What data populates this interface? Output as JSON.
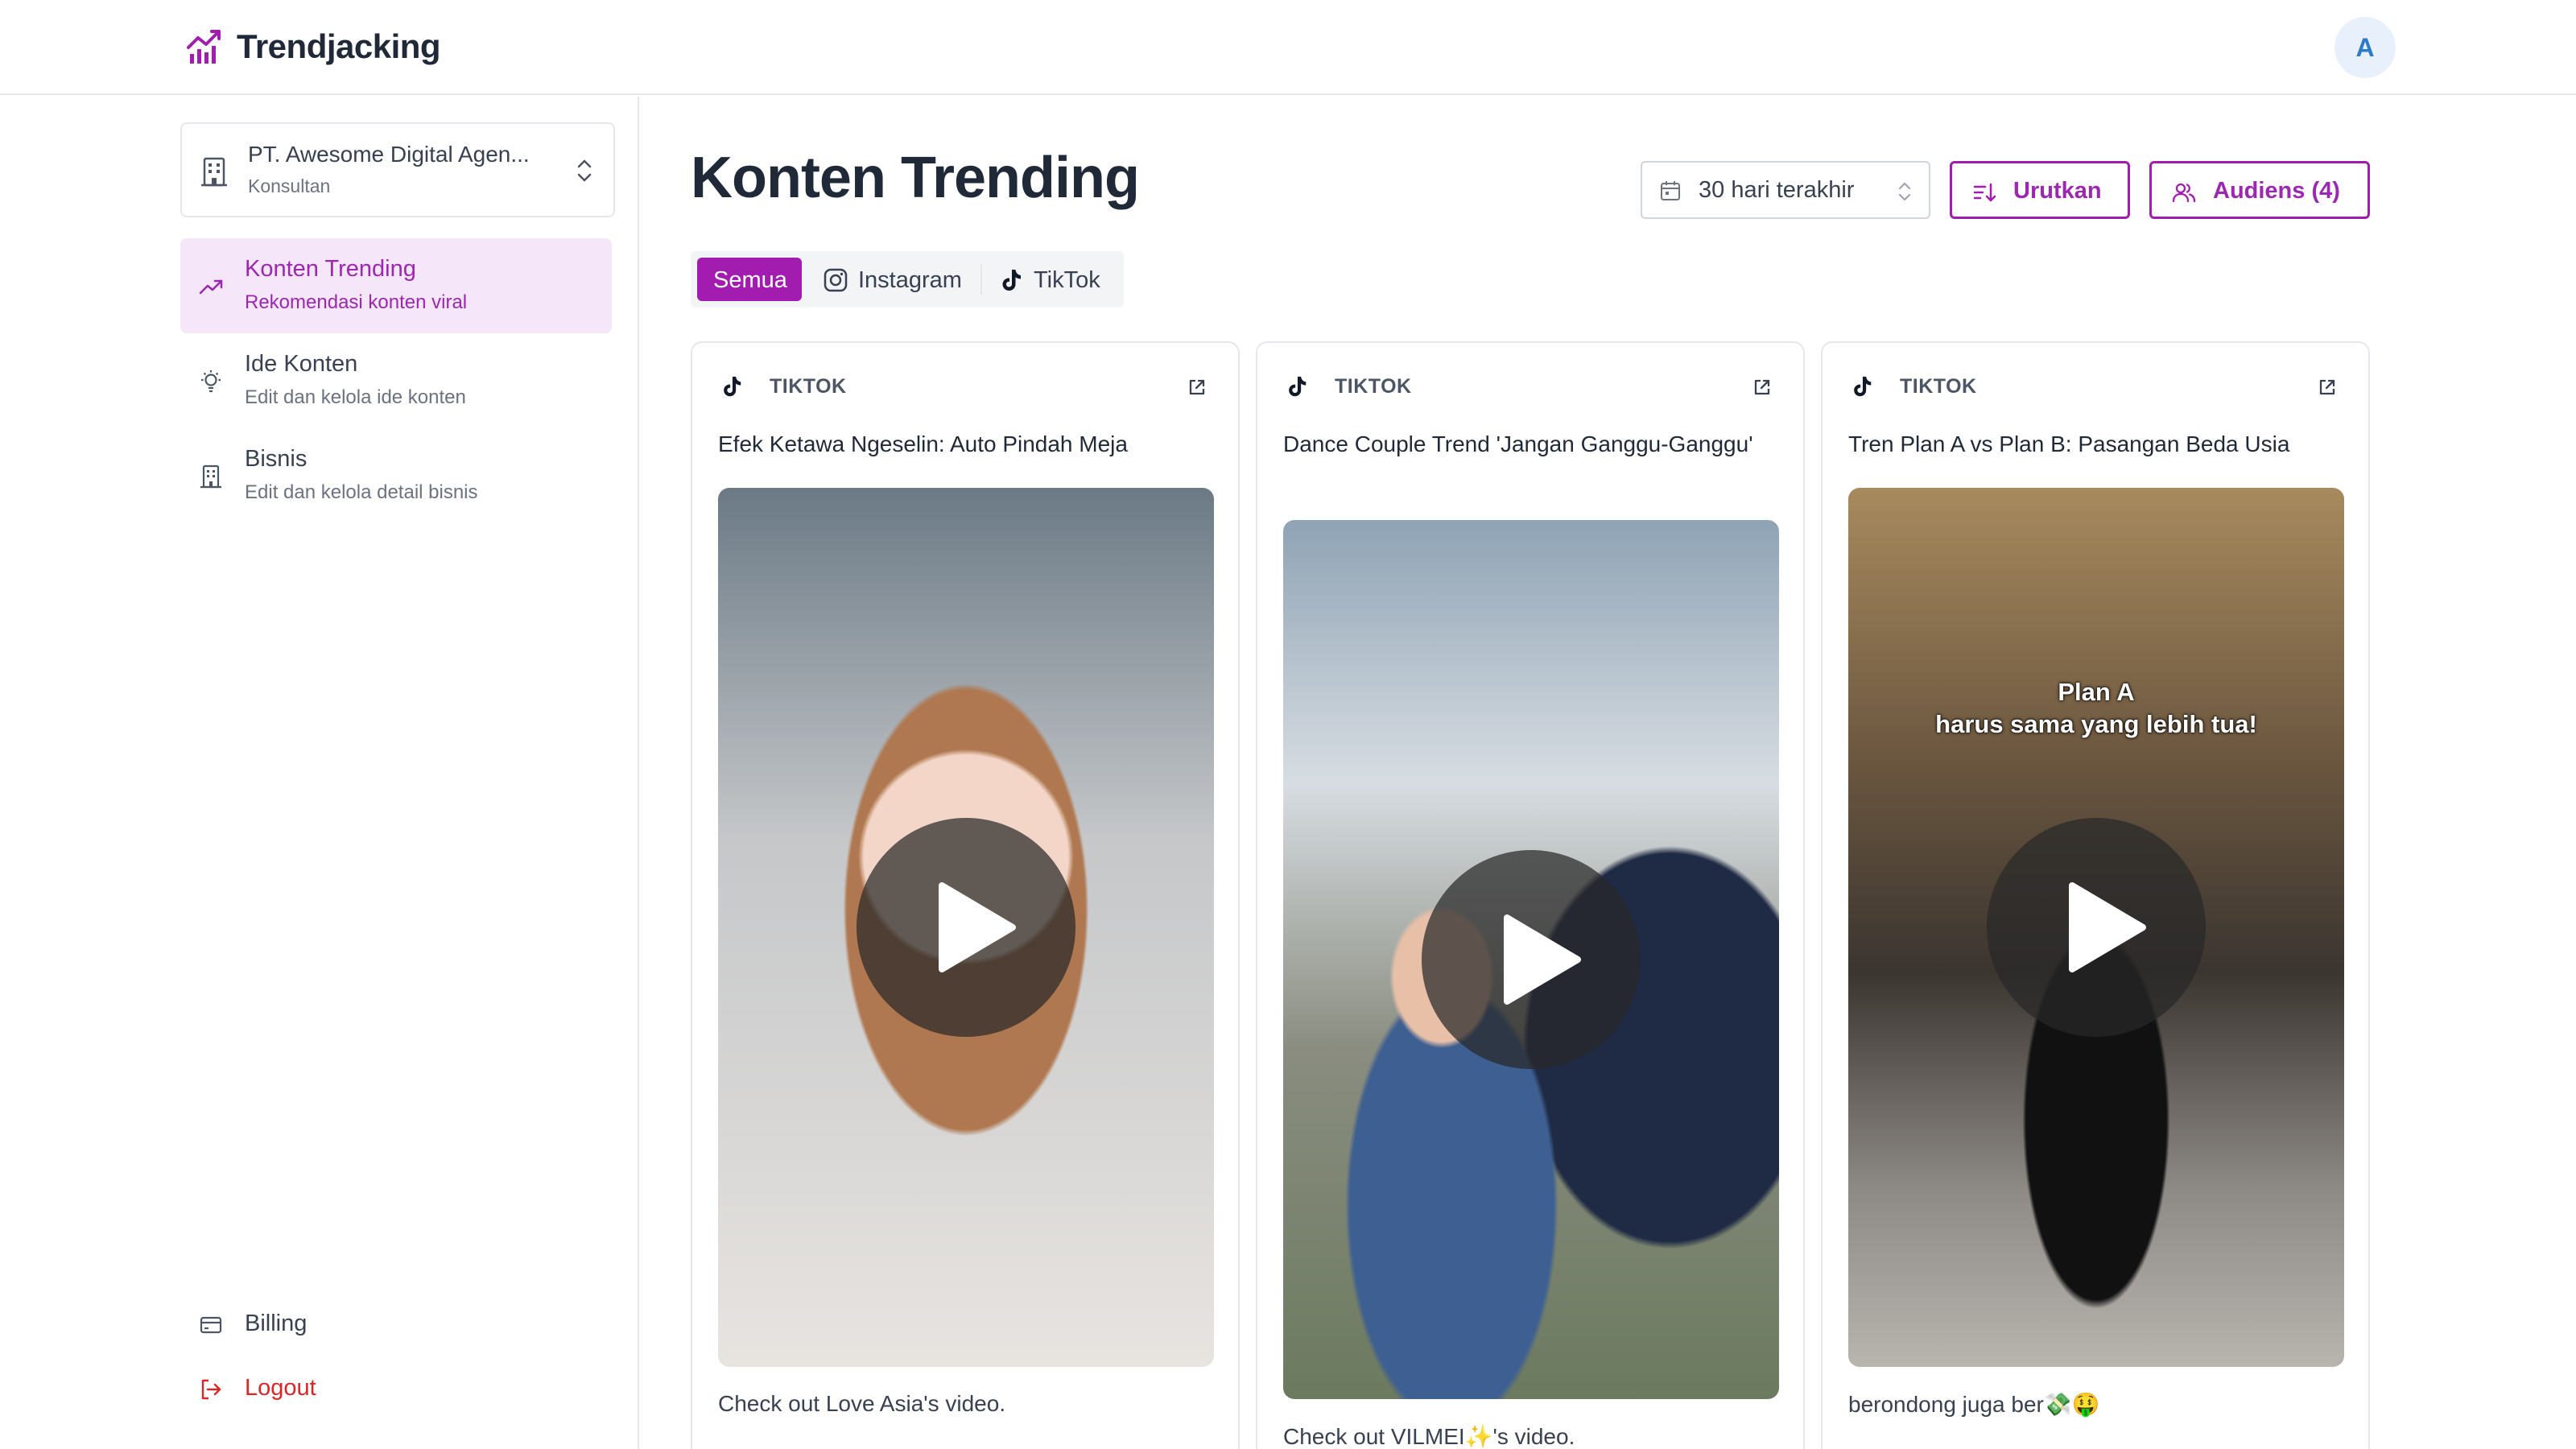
{
  "header": {
    "brand": "Trendjacking",
    "avatar_initial": "A"
  },
  "sidebar": {
    "org": {
      "name": "PT. Awesome Digital Agen...",
      "role": "Konsultan"
    },
    "items": [
      {
        "title": "Konten Trending",
        "subtitle": "Rekomendasi konten viral",
        "icon": "trending-up-icon",
        "active": true
      },
      {
        "title": "Ide Konten",
        "subtitle": "Edit dan kelola ide konten",
        "icon": "lightbulb-icon",
        "active": false
      },
      {
        "title": "Bisnis",
        "subtitle": "Edit dan kelola detail bisnis",
        "icon": "building-icon",
        "active": false
      }
    ],
    "billing_label": "Billing",
    "logout_label": "Logout"
  },
  "main": {
    "title": "Konten Trending",
    "date_range": "30 hari terakhir",
    "sort_label": "Urutkan",
    "audience_label": "Audiens (4)",
    "tabs": [
      {
        "label": "Semua",
        "active": true
      },
      {
        "label": "Instagram",
        "active": false
      },
      {
        "label": "TikTok",
        "active": false
      }
    ]
  },
  "cards": [
    {
      "platform": "TIKTOK",
      "title": "Efek Ketawa Ngeselin: Auto Pindah Meja",
      "description": "Check out Love Asia's video."
    },
    {
      "platform": "TIKTOK",
      "title": "Dance Couple Trend 'Jangan Ganggu-Ganggu'",
      "description": "Check out VILMEI✨'s video."
    },
    {
      "platform": "TIKTOK",
      "title": "Tren Plan A vs Plan B: Pasangan Beda Usia",
      "description": "berondong juga ber💸🤑",
      "overlay_line1": "Plan A",
      "overlay_line2": "harus sama yang lebih tua!"
    }
  ],
  "colors": {
    "accent": "#a21caf",
    "accent_bg": "#f6e6fa",
    "logout": "#dc2626",
    "avatar_bg": "#e8f1fb"
  }
}
